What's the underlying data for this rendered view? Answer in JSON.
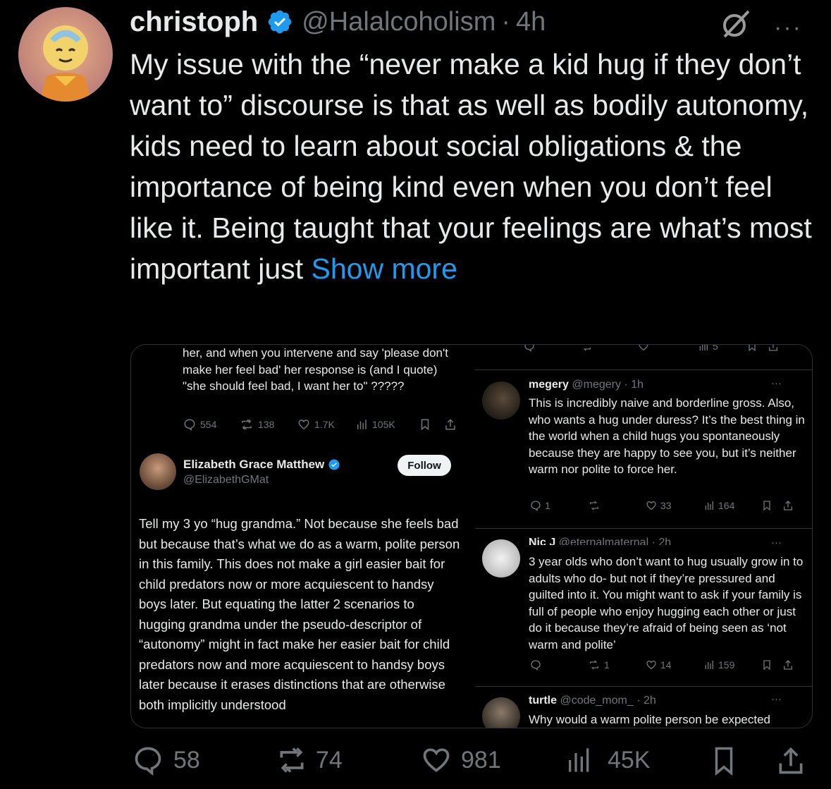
{
  "tweet": {
    "author_name": "christoph",
    "handle": "@Halalcoholism",
    "separator": "·",
    "time": "4h",
    "more": "···",
    "text": "My issue with the “never make a kid hug if they don’t want to” discourse is that as well as bodily autonomy, kids need to learn about social obligations & the importance of being kind even when you don’t feel like it. Being taught that your feelings are what’s most important just",
    "show_more": "Show more"
  },
  "embed": {
    "left": {
      "top_text": "her, and when you intervene and say 'please don't make her feel bad' her response is (and I quote) \"she should feel bad, I want her to\" ?????",
      "actions": {
        "replies": "554",
        "reposts": "138",
        "likes": "1.7K",
        "views": "105K"
      },
      "reply_author": "Elizabeth Grace Matthew",
      "reply_handle": "@ElizabethGMat",
      "follow_label": "Follow",
      "reply_text": "Tell my 3 yo “hug grandma.” Not because she feels bad but because that’s what we do as a warm, polite person in this family. This does not make a girl easier bait for child predators now or more acquiescent to handsy boys later. But equating the latter 2 scenarios to hugging grandma under the pseudo-descriptor of “autonomy” might in fact make her easier bait for child predators now and more acquiescent to handsy boys later because it erases distinctions that are otherwise both implicitly understood"
    },
    "right": {
      "top_actions": {
        "views": "5"
      },
      "replies": [
        {
          "name": "megery",
          "handle": "@megery · 1h",
          "text": "This is incredibly naive and borderline gross. Also, who wants a hug under duress? It’s the best thing in the world when a child hugs you spontaneously because they are happy to see you, but it’s neither warm nor polite to force her.",
          "replies": "1",
          "reposts": "",
          "likes": "33",
          "views": "164"
        },
        {
          "name": "Nic J",
          "handle": "@eternalmaternal · 2h",
          "text": "3 year olds who don’t want to hug usually grow in to adults who do- but not if they’re pressured and guilted into it. You might want to ask if your family is full of people who enjoy hugging each other or just do it because they’re afraid of being seen as ‘not warm and polite’",
          "replies": "",
          "reposts": "1",
          "likes": "14",
          "views": "159"
        },
        {
          "name": "turtle",
          "handle": "@code_mom_ · 2h",
          "text": "Why would a warm polite person be expected"
        }
      ],
      "more": "···"
    }
  },
  "actions": {
    "replies": "58",
    "reposts": "74",
    "likes": "981",
    "views": "45K"
  },
  "colors": {
    "accent": "#1d9bf0",
    "muted": "#71767b",
    "background": "#000000",
    "text": "#e7e9ea"
  },
  "icons": [
    "verified-icon",
    "grok-icon",
    "more-icon",
    "reply-icon",
    "repost-icon",
    "like-icon",
    "views-icon",
    "bookmark-icon",
    "share-icon"
  ]
}
